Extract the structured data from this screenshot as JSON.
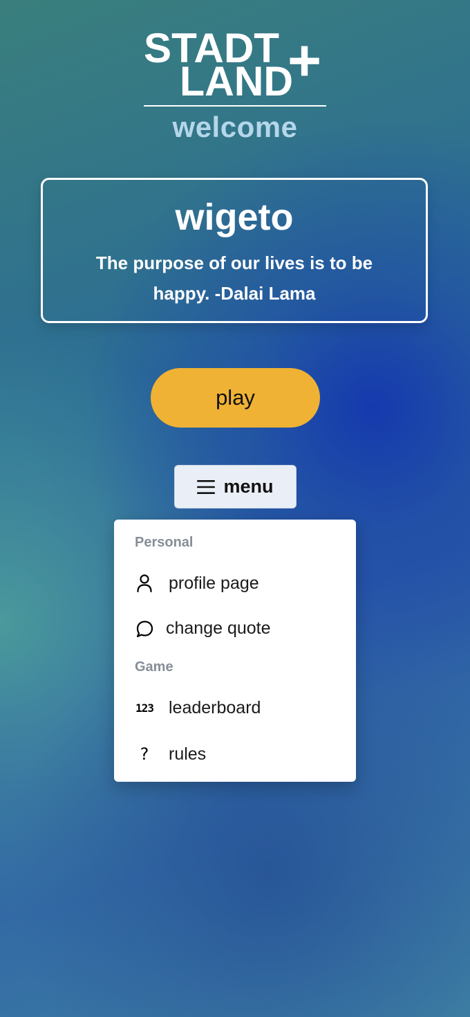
{
  "logo": {
    "line1": "STADT",
    "line2": "LAND",
    "plus": "+"
  },
  "welcome": "welcome",
  "user": {
    "name": "wigeto",
    "quote": "The purpose of our lives is to be happy. -Dalai Lama"
  },
  "play_label": "play",
  "menu": {
    "label": "menu",
    "sections": [
      {
        "header": "Personal",
        "items": [
          {
            "label": "profile page",
            "icon": "user-icon"
          },
          {
            "label": "change quote",
            "icon": "speech-bubble-icon"
          }
        ]
      },
      {
        "header": "Game",
        "items": [
          {
            "label": "leaderboard",
            "icon": "numbers-123-icon",
            "icon_text": "123"
          },
          {
            "label": "rules",
            "icon": "question-mark-icon",
            "icon_text": "?"
          }
        ]
      }
    ]
  },
  "colors": {
    "play_button": "#efb234",
    "welcome_text": "#b5d6ea",
    "menu_button_bg": "#eaeff7",
    "section_header": "#868e96"
  }
}
